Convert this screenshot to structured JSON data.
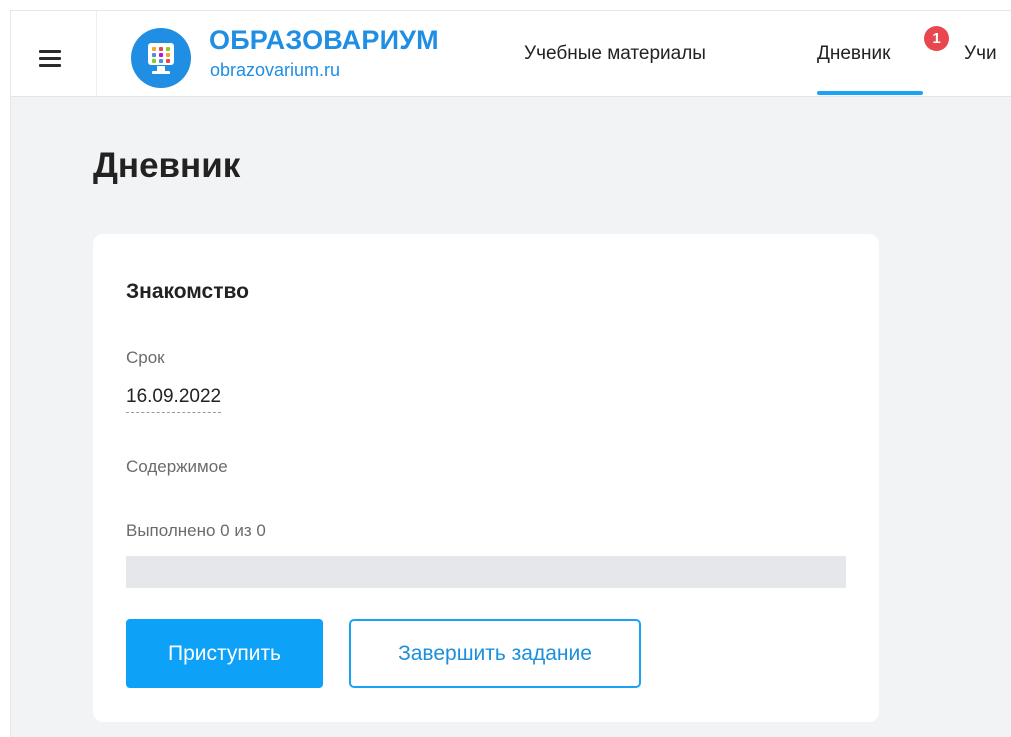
{
  "header": {
    "logo": {
      "title": "ОБРАЗОВАРИУМ",
      "subtitle": "obrazovarium.ru",
      "icon": "monitor-grid-icon"
    },
    "menu_icon": "hamburger-menu-icon",
    "nav": {
      "materials": "Учебные материалы",
      "diary": "Дневник",
      "diary_badge": "1",
      "teach": "Учи"
    },
    "active_tab": "diary"
  },
  "page": {
    "title": "Дневник"
  },
  "task_card": {
    "title": "Знакомство",
    "deadline_label": "Срок",
    "deadline_value": "16.09.2022",
    "content_label": "Содержимое",
    "progress_label": "Выполнено 0 из 0",
    "progress_done": 0,
    "progress_total": 0,
    "start_button": "Приступить",
    "finish_button": "Завершить задание"
  },
  "colors": {
    "brand": "#1f8ee3",
    "accent": "#0da2f7",
    "badge": "#e8474f",
    "background": "#f2f3f5"
  }
}
